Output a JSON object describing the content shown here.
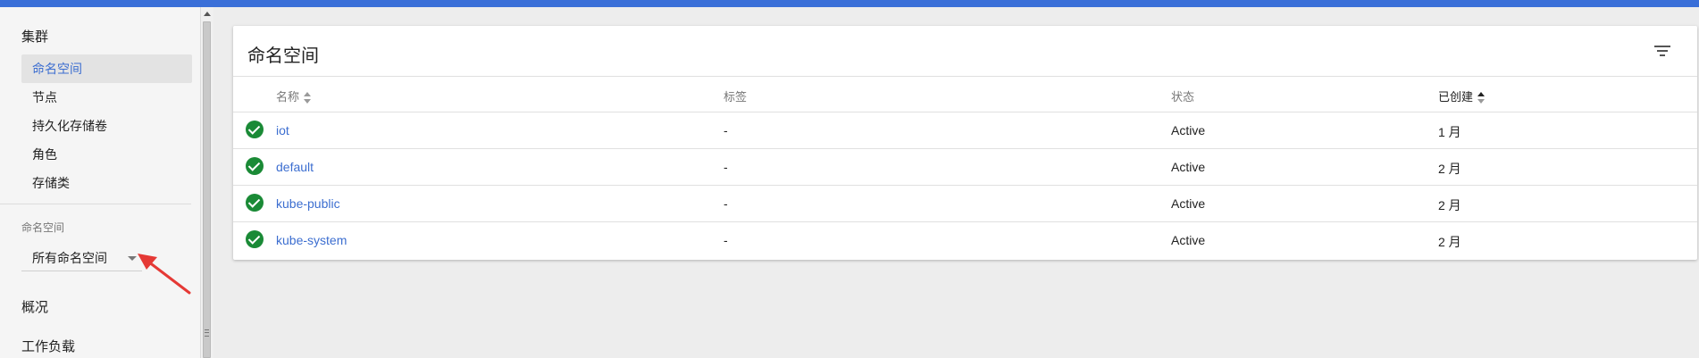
{
  "colors": {
    "topbar": "#3a6fd8",
    "link": "#3c6ed0",
    "status_ok": "#1a8a36",
    "annotation_arrow": "#e53935"
  },
  "sidebar": {
    "cluster_header": "集群",
    "cluster_items": [
      {
        "label": "命名空间",
        "active": true
      },
      {
        "label": "节点"
      },
      {
        "label": "持久化存储卷"
      },
      {
        "label": "角色"
      },
      {
        "label": "存储类"
      }
    ],
    "namespace_label": "命名空间",
    "namespace_select": "所有命名空间",
    "overview": "概况",
    "workloads": "工作负载"
  },
  "card": {
    "title": "命名空间",
    "filter_icon": "filter-icon",
    "columns": [
      "名称",
      "标签",
      "状态",
      "已创建"
    ],
    "rows": [
      {
        "name": "iot",
        "labels": "-",
        "status": "Active",
        "created": "1 月"
      },
      {
        "name": "default",
        "labels": "-",
        "status": "Active",
        "created": "2 月"
      },
      {
        "name": "kube-public",
        "labels": "-",
        "status": "Active",
        "created": "2 月"
      },
      {
        "name": "kube-system",
        "labels": "-",
        "status": "Active",
        "created": "2 月"
      }
    ]
  }
}
